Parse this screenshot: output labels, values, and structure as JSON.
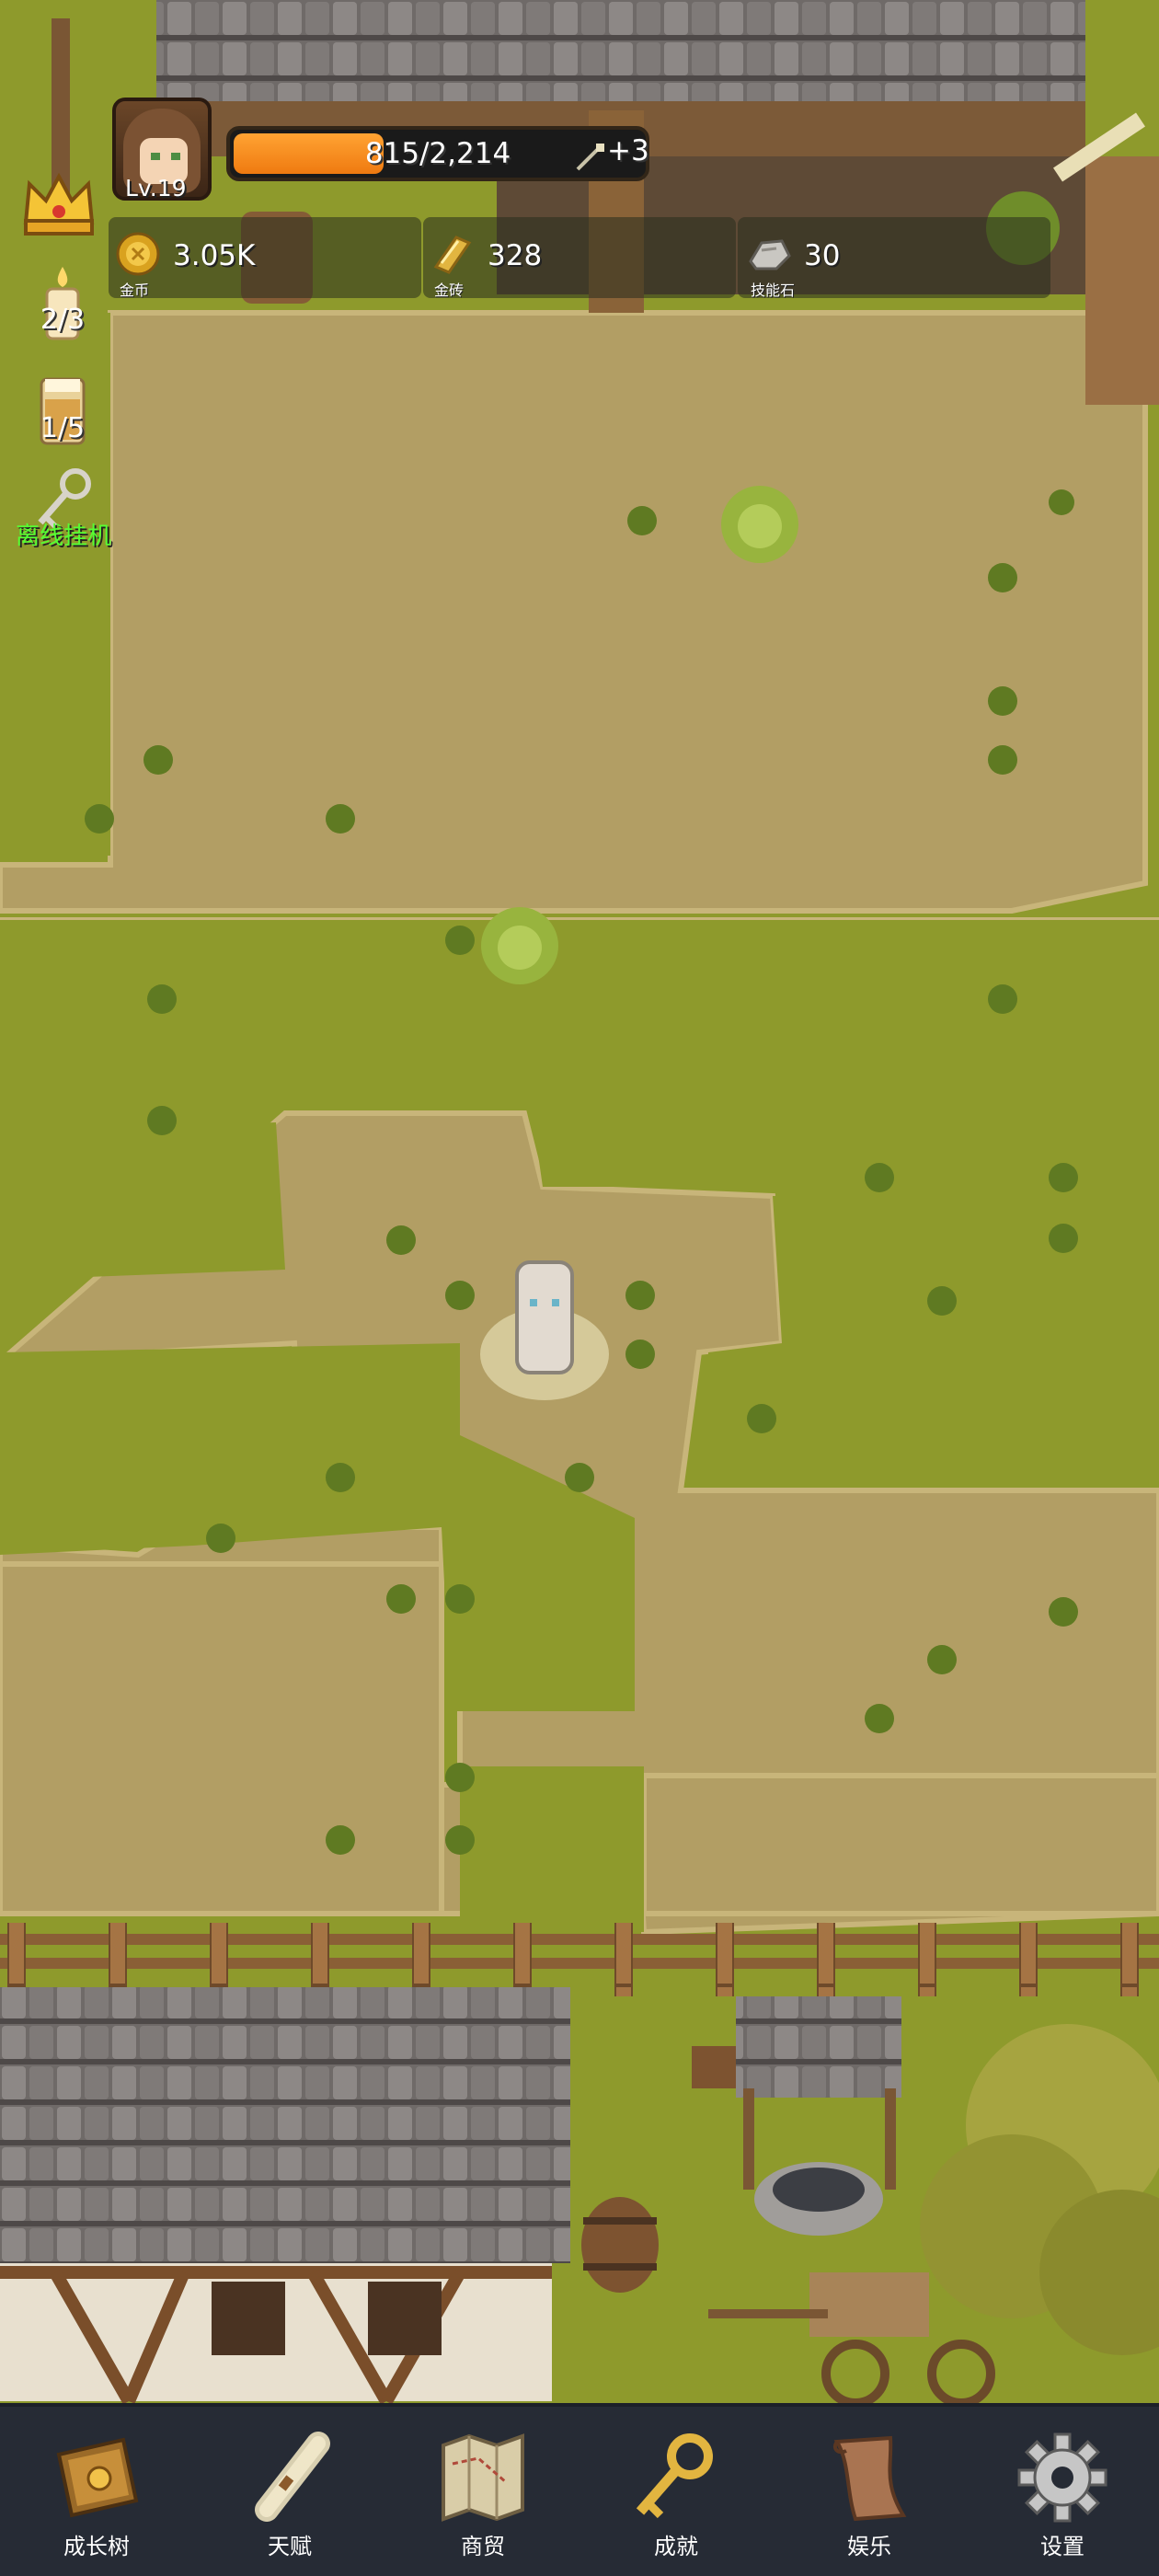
{
  "player": {
    "level": "Lv.19",
    "xp_text": "815/2,214",
    "xp_fraction": 0.368,
    "xp_bonus": "+3"
  },
  "resources": [
    {
      "name": "coin",
      "value": "3.05K",
      "label": "金币",
      "icon": "gold-coin-icon"
    },
    {
      "name": "gold-brick",
      "value": "328",
      "label": "金砖",
      "icon": "gold-brick-icon"
    },
    {
      "name": "skill-stone",
      "value": "30",
      "label": "技能石",
      "icon": "skill-stone-icon"
    }
  ],
  "side_buttons": {
    "crown": {
      "icon": "crown-icon"
    },
    "candle": {
      "count": "2/3",
      "icon": "candle-icon"
    },
    "drink": {
      "count": "1/5",
      "icon": "mug-icon"
    },
    "auto_idle": {
      "label": "离线挂机",
      "icon": "key-icon"
    }
  },
  "nav": {
    "items": [
      {
        "label": "成长树",
        "icon": "book-icon"
      },
      {
        "label": "天赋",
        "icon": "scroll-icon"
      },
      {
        "label": "商贸",
        "icon": "map-icon"
      },
      {
        "label": "成就",
        "icon": "key-icon"
      },
      {
        "label": "娱乐",
        "icon": "parchment-icon"
      },
      {
        "label": "设置",
        "icon": "gear-icon"
      }
    ]
  },
  "colors": {
    "grass": "#8e9a2c",
    "dirt": "#b29e64",
    "xp_bar": "#ef7a10",
    "nav_bg": "#262b35",
    "idle_label": "#55ff33"
  }
}
